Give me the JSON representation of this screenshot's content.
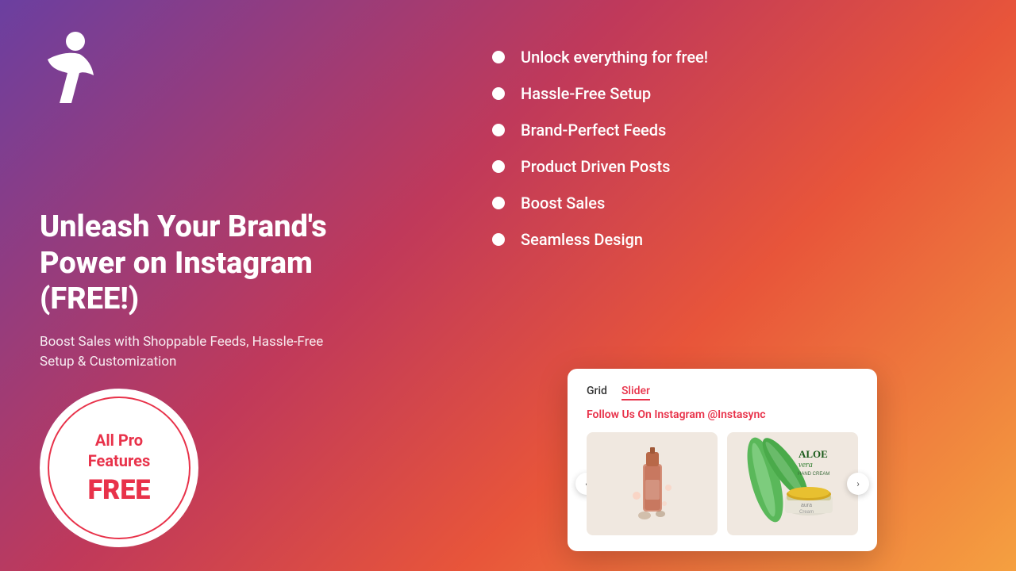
{
  "background": {
    "gradient_desc": "purple to red to orange gradient"
  },
  "logo": {
    "alt": "Instasync Logo"
  },
  "left": {
    "heading": "Unleash Your Brand's Power on Instagram (FREE!)",
    "subheading": "Boost Sales with Shoppable Feeds, Hassle-Free Setup & Customization"
  },
  "badge": {
    "line1": "All Pro",
    "line2": "Features",
    "line3": "FREE"
  },
  "features": [
    "Unlock everything for free!",
    "Hassle-Free Setup",
    "Brand-Perfect Feeds",
    "Product Driven Posts",
    "Boost Sales",
    "Seamless Design"
  ],
  "widget": {
    "tab1": "Grid",
    "tab2": "Slider",
    "follow_prefix": "Follow Us On Instagram ",
    "follow_handle": "@Instasync",
    "image1_alt": "Perfume product",
    "image2_alt": "Aloe vera cream product",
    "aloe_brand": "ALOEera",
    "aloe_sub": "HAND CREAM",
    "cream_brand": "aura",
    "cream_sub": "Cream"
  }
}
